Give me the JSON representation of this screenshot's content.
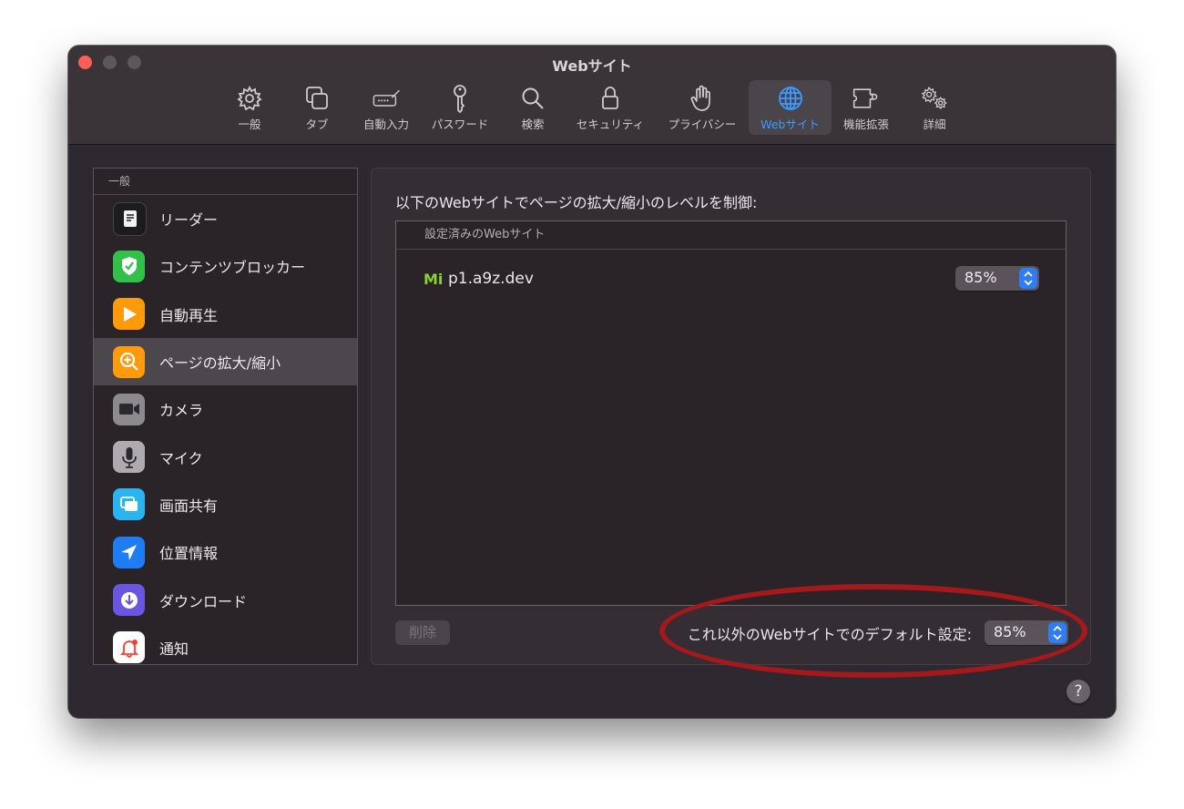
{
  "window": {
    "title": "Webサイト"
  },
  "toolbar": {
    "items": [
      {
        "label": "一般",
        "icon": "gear-icon"
      },
      {
        "label": "タブ",
        "icon": "tabs-icon"
      },
      {
        "label": "自動入力",
        "icon": "autofill-icon"
      },
      {
        "label": "パスワード",
        "icon": "key-icon"
      },
      {
        "label": "検索",
        "icon": "magnifier-icon"
      },
      {
        "label": "セキュリティ",
        "icon": "lock-icon"
      },
      {
        "label": "プライバシー",
        "icon": "hand-icon"
      },
      {
        "label": "Webサイト",
        "icon": "globe-icon",
        "selected": true
      },
      {
        "label": "機能拡張",
        "icon": "puzzle-icon"
      },
      {
        "label": "詳細",
        "icon": "gears-icon"
      }
    ],
    "active_color": "#3f9bff"
  },
  "sidebar": {
    "header": "一般",
    "items": [
      {
        "label": "リーダー",
        "icon": "reader-icon"
      },
      {
        "label": "コンテンツブロッカー",
        "icon": "content-blocker-icon"
      },
      {
        "label": "自動再生",
        "icon": "autoplay-icon"
      },
      {
        "label": "ページの拡大/縮小",
        "icon": "page-zoom-icon",
        "selected": true
      },
      {
        "label": "カメラ",
        "icon": "camera-icon"
      },
      {
        "label": "マイク",
        "icon": "microphone-icon"
      },
      {
        "label": "画面共有",
        "icon": "screen-sharing-icon"
      },
      {
        "label": "位置情報",
        "icon": "location-icon"
      },
      {
        "label": "ダウンロード",
        "icon": "download-icon"
      },
      {
        "label": "通知",
        "icon": "notification-icon"
      }
    ]
  },
  "main": {
    "heading": "以下のWebサイトでページの拡大/縮小のレベルを制御:",
    "table": {
      "header": "設定済みのWebサイト",
      "rows": [
        {
          "favicon": "Mi",
          "site": "p1.a9z.dev",
          "zoom": "85%"
        }
      ]
    },
    "delete_label": "削除",
    "default_label": "これ以外のWebサイトでのデフォルト設定:",
    "default_value": "85%"
  },
  "help_label": "?",
  "annotation_color": "#a5181c"
}
